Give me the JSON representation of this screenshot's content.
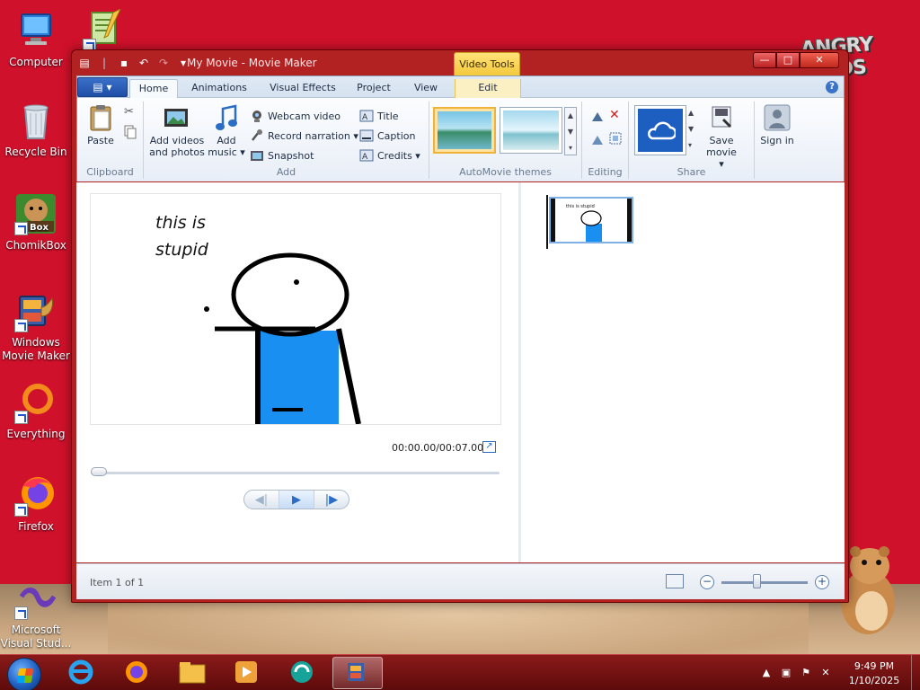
{
  "desktop": {
    "icons": [
      {
        "label": "Computer",
        "icon": "computer-icon"
      },
      {
        "label": "",
        "icon": "notepad-plus-icon"
      },
      {
        "label": "Recycle Bin",
        "icon": "recycle-bin-icon"
      },
      {
        "label": "ChomikBox",
        "icon": "chomikbox-icon"
      },
      {
        "label": "Windows Movie Maker",
        "icon": "movie-maker-icon"
      },
      {
        "label": "Everything",
        "icon": "everything-icon"
      },
      {
        "label": "Firefox",
        "icon": "firefox-icon"
      },
      {
        "label": "Microsoft Visual Stud...",
        "icon": "visual-studio-icon"
      }
    ],
    "wallpaper_logo": "ANGRY BIRDS",
    "accent": "#d0112b"
  },
  "window": {
    "title": "My Movie - Movie Maker",
    "context_tab_group": "Video Tools",
    "controls": {
      "minimize": "—",
      "maximize": "□",
      "close": "✕"
    }
  },
  "ribbon": {
    "tabs": [
      "Home",
      "Animations",
      "Visual Effects",
      "Project",
      "View",
      "Edit"
    ],
    "active_tab": "Home",
    "help": "?",
    "groups": {
      "clipboard": {
        "label": "Clipboard",
        "paste": "Paste"
      },
      "add": {
        "label": "Add",
        "add_videos": "Add videos and photos",
        "add_music": "Add music ▾",
        "webcam": "Webcam video",
        "narration": "Record narration ▾",
        "snapshot": "Snapshot",
        "title": "Title",
        "caption": "Caption",
        "credits": "Credits ▾"
      },
      "themes": {
        "label": "AutoMovie themes"
      },
      "editing": {
        "label": "Editing"
      },
      "share": {
        "label": "Share",
        "save_movie": "Save movie ▾",
        "sign_in": "Sign in"
      }
    }
  },
  "preview": {
    "caption_line1": "this is",
    "caption_line2": "stupid",
    "timecode": "00:00.00/00:07.00",
    "seek_progress": 0.0
  },
  "storyboard": {
    "items": [
      {
        "caption": "this is stupid"
      }
    ]
  },
  "status": {
    "text": "Item 1 of 1",
    "zoom_minus": "−",
    "zoom_plus": "+",
    "zoom_level": 0.4
  },
  "taskbar": {
    "apps": [
      {
        "name": "internet-explorer-icon"
      },
      {
        "name": "firefox-icon"
      },
      {
        "name": "file-explorer-icon"
      },
      {
        "name": "media-player-icon"
      },
      {
        "name": "teal-app-icon"
      },
      {
        "name": "movie-maker-icon"
      }
    ],
    "time": "9:49 PM",
    "date": "1/10/2025"
  }
}
